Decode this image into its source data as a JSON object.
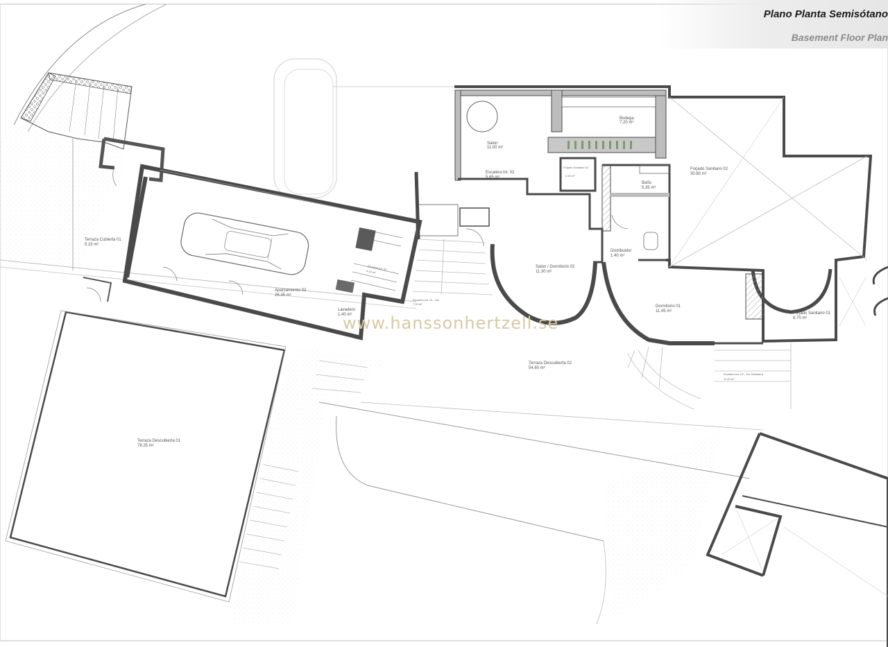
{
  "header": {
    "title": "Plano Planta Semisótano",
    "subtitle": "Basement Floor Plan"
  },
  "watermark": "www.hanssonhertzell.se",
  "rooms": {
    "bodega": {
      "name": "Bodega",
      "area": "7.20 m²"
    },
    "salon": {
      "name": "Salon",
      "area": "11.00 m²"
    },
    "escalera_int_02": {
      "name": "Escalera int. 02",
      "area": "5.65 m²"
    },
    "forjado_sanitario_03": {
      "name": "Forjado Sanitario 03",
      "area": "0.90 m²"
    },
    "bano": {
      "name": "Baño",
      "area": "5.35 m²"
    },
    "forjado_sanitario_02": {
      "name": "Forjado Sanitario 02",
      "area": "30.80 m²"
    },
    "terraza_cubierta_01": {
      "name": "Terraza Cubierta 01",
      "area": "9.15 m²"
    },
    "aparcamiento_02": {
      "name": "Aparcamiento 02",
      "area": "26.35 m²"
    },
    "escalera_int_01": {
      "name": "Escalera int. 01",
      "area": "6.10 m²"
    },
    "lavadero": {
      "name": "Lavadero",
      "area": "1.40 m²"
    },
    "escalera_ext_01": {
      "name": "Escalera ext. 01 - Sur",
      "area": "7.15 m²"
    },
    "salon_dormitorio_02": {
      "name": "Salon / Dormitorio 02",
      "area": "11.30 m²"
    },
    "distribuidor": {
      "name": "Distribuidor",
      "area": "1.40 m²"
    },
    "dormitorio_01": {
      "name": "Dormitorio 01",
      "area": "11.45 m²"
    },
    "forjado_sanitario_01": {
      "name": "Forjado Sanitario 01",
      "area": "8.70 m²"
    },
    "terraza_descubierta_02": {
      "name": "Terraza Descubierta 02",
      "area": "54.60 m²"
    },
    "escalera_ext_02": {
      "name": "Escalera ext. 02 - Sur Delantera",
      "area": "11.00 m²"
    },
    "terraza_descubierta_01": {
      "name": "Terraza Descubierta 01",
      "area": "78.25 m²"
    }
  }
}
